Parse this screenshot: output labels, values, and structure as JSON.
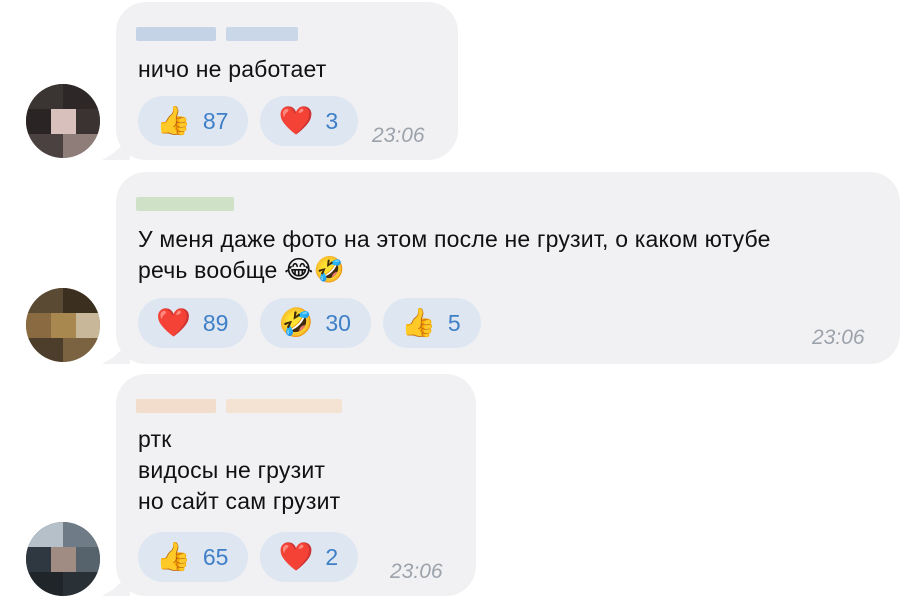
{
  "messages": [
    {
      "text_lines": [
        "ничо не работает"
      ],
      "reactions": [
        {
          "icon": "thumbs-up-icon",
          "emoji": "👍",
          "count": "87"
        },
        {
          "icon": "heart-icon",
          "emoji": "❤️",
          "count": "3"
        }
      ],
      "time": "23:06"
    },
    {
      "text_lines": [
        "У меня даже фото на этом после не грузит, о каком ютубе",
        "речь вообще"
      ],
      "inline_emoji": "😂🤣",
      "reactions": [
        {
          "icon": "heart-icon",
          "emoji": "❤️",
          "count": "89"
        },
        {
          "icon": "rofl-icon",
          "emoji": "🤣",
          "count": "30"
        },
        {
          "icon": "thumbs-up-icon",
          "emoji": "👍",
          "count": "5"
        }
      ],
      "time": "23:06"
    },
    {
      "text_lines": [
        "ртк",
        "видосы не грузит",
        "но сайт сам грузит"
      ],
      "reactions": [
        {
          "icon": "thumbs-up-icon",
          "emoji": "👍",
          "count": "65"
        },
        {
          "icon": "heart-icon",
          "emoji": "❤️",
          "count": "2"
        }
      ],
      "time": "23:06"
    }
  ],
  "colors": {
    "bubble": "#f1f1f4",
    "reaction_bg": "#dde6f1",
    "reaction_count": "#3f7fc7",
    "time": "#9da3ab"
  }
}
